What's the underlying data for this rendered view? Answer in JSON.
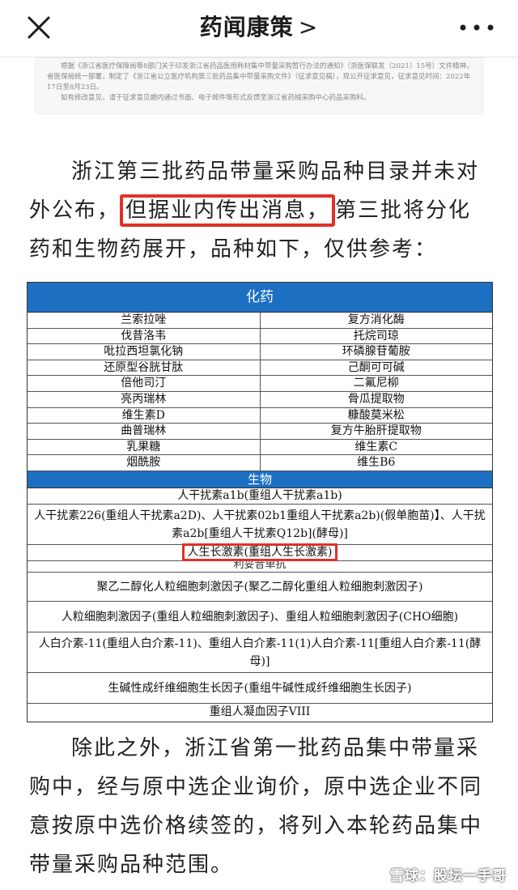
{
  "header": {
    "title": "药闻康策",
    "chevron": ">"
  },
  "doc_snippet": {
    "line1": "根据《浙江省医疗保障局等8部门关于印发浙江省药品医用耗材集中带量采购暂行办法的通知》（浙医保联发〔2021〕15号）文件精神，按照",
    "line2": "省医保局统一部署，制定了《浙江省公立医疗机构第三批药品集中带量采购文件》（征求意见稿），现公开征求意见，征求意见时间：2022年8月",
    "line3": "17日至8月23日。",
    "line4": "如有修改意见，请于征求意见期内通过书面、电子邮件等形式反馈至浙江省药械采购中心药品采购科。"
  },
  "para1": {
    "part1": "浙江第三批药品带量采购品种目录并未对外公布，",
    "highlight": "但据业内传出消息，",
    "part2": "第三批将分化药和生物药展开，品种如下，仅供参考："
  },
  "table": {
    "chem_header": "化药",
    "chem_rows": [
      [
        "兰索拉唑",
        "复方消化酶"
      ],
      [
        "伐昔洛韦",
        "托烷司琼"
      ],
      [
        "吡拉西坦氯化钠",
        "环磷腺苷葡胺"
      ],
      [
        "还原型谷胱甘肽",
        "己酮可可碱"
      ],
      [
        "倍他司汀",
        "二氟尼柳"
      ],
      [
        "亮丙瑞林",
        "骨瓜提取物"
      ],
      [
        "维生素D",
        "糠酸莫米松"
      ],
      [
        "曲普瑞林",
        "复方牛胎肝提取物"
      ],
      [
        "乳果糖",
        "维生素C"
      ],
      [
        "烟酰胺",
        "维生B6"
      ]
    ],
    "bio_header": "生物",
    "bio_rows": {
      "alb": "人干扰素a1b(重组人干扰素a1b)",
      "ifn226": "人干扰素226(重组人干扰素a2D)、人干扰素02b1重组人干扰素a2b)(假单胞苗)】、人干扰素a2b[重组人干扰素Q12b](酵母)]",
      "gh": "人生长激素(重组人生长激素)",
      "cut": "利妥昔单抗",
      "peg": "聚乙二醇化人粒细胞刺激因子(聚乙二醇化重组人粒细胞刺激因子)",
      "gcsf": "人粒细胞刺激因子(重组人粒细胞刺激因子)、重组人粒细胞刺激因子(CHO细胞)",
      "il11": "人白介素-11(重组人白介素-11)、重组人白介素-11(1)人白介素-11[重组人白介素-11(酵母)]",
      "bfgf": "生碱性成纤维细胞生长因子(重组牛碱性成纤维细胞生长因子)",
      "f8": "重组人凝血因子VIII"
    }
  },
  "para2": "除此之外，浙江省第一批药品集中带量采购中，经与原中选企业询价，原中选企业不同意按原中选价格续签的，将列入本轮药品集中带量采购品种范围。",
  "watermark": "雪球：股坛一手哥",
  "colors": {
    "table_header": "#1d6fc1",
    "highlight": "#e0302a"
  }
}
